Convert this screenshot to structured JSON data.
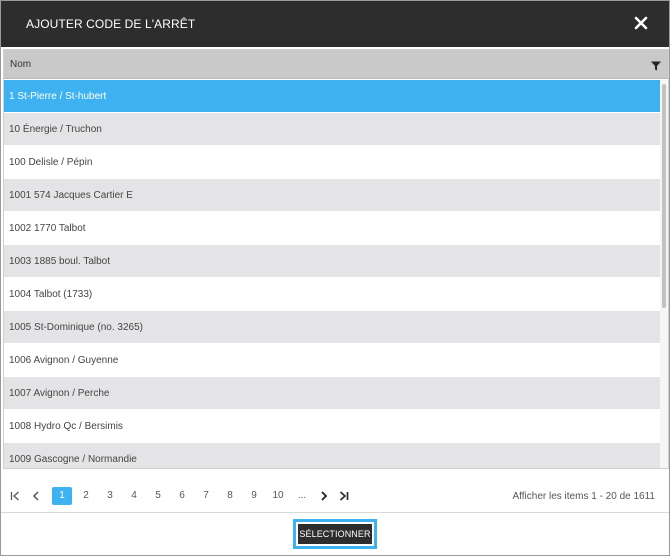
{
  "dialog": {
    "title": "AJOUTER CODE DE L'ARRÊT",
    "close_icon": "close-icon"
  },
  "grid": {
    "column_header": "Nom",
    "filter_icon": "filter-icon",
    "rows": [
      "1 St-Pierre / St-hubert",
      "10 Énergie / Truchon",
      "100 Delisle / Pépin",
      "1001 574 Jacques Cartier E",
      "1002 1770 Talbot",
      "1003 1885 boul. Talbot",
      "1004 Talbot (1733)",
      "1005 St-Dominique (no. 3265)",
      "1006 Avignon / Guyenne",
      "1007 Avignon / Perche",
      "1008 Hydro Qc / Bersimis",
      "1009 Gascogne / Normandie"
    ],
    "selected_index": 0
  },
  "pager": {
    "pages": [
      "1",
      "2",
      "3",
      "4",
      "5",
      "6",
      "7",
      "8",
      "9",
      "10",
      "..."
    ],
    "current_page": "1",
    "info": "Afficher les items 1 - 20 de 1611"
  },
  "footer": {
    "select_label": "SÉLECTIONNER"
  },
  "colors": {
    "accent": "#3eb2f0",
    "titlebar": "#2d2d2d",
    "header": "#c9c9c9",
    "row_alt": "#e4e4e6"
  }
}
